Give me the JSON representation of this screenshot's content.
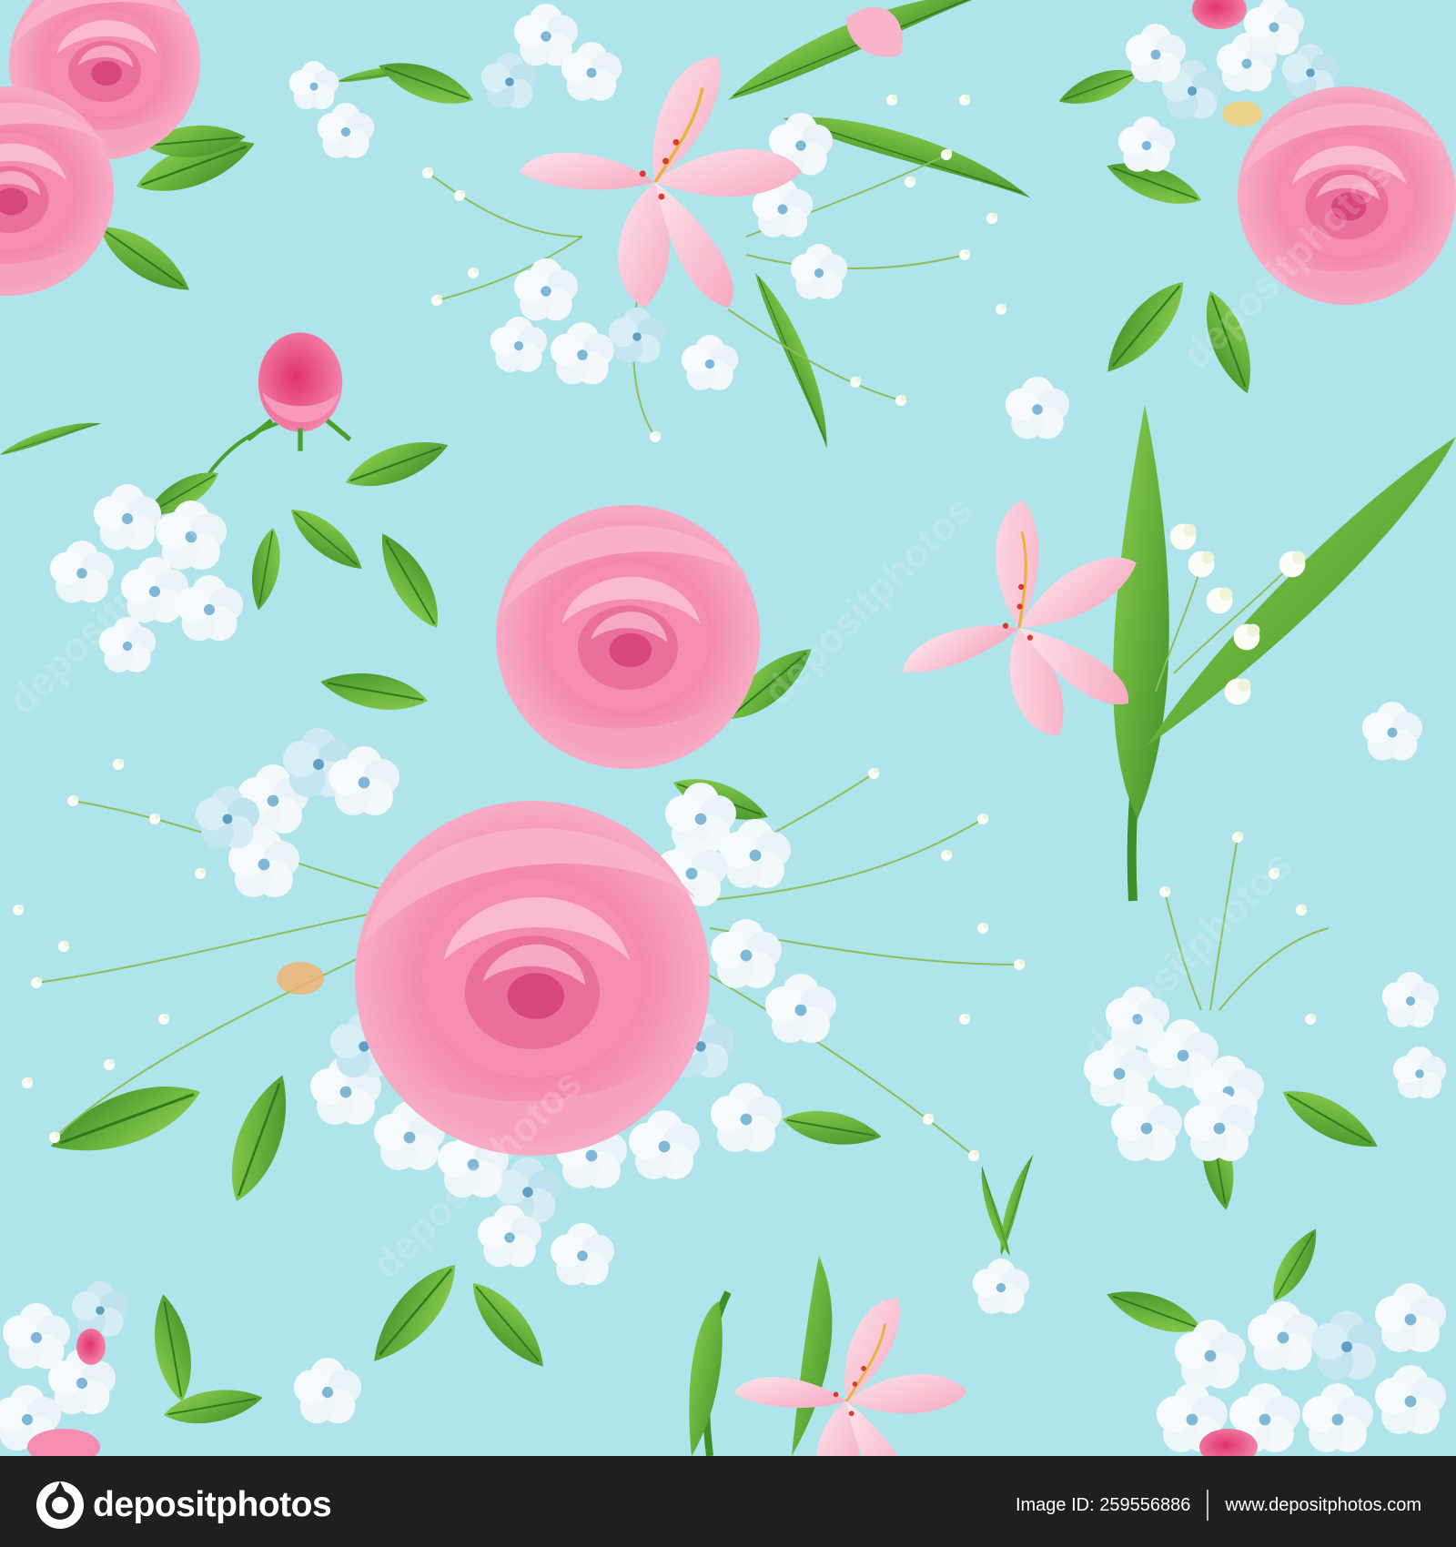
{
  "image": {
    "background_color": "#aee4ea",
    "rose_pink": "#f27fa6",
    "rose_light": "#f9b4cb",
    "leaf_green": "#4a9e2c",
    "leaf_light": "#7cc443",
    "phlox_white": "#f3f8fb",
    "phlox_blue": "#bfe3ee",
    "alstroemeria_pink": "#fbc4d4"
  },
  "watermark": {
    "text": "depositphotos"
  },
  "footer": {
    "background_color": "#1f1f1f",
    "brand": "depositphotos",
    "logo_icon": "camera-shutter-icon",
    "image_id_label": "Image ID: 259556886",
    "site_url": "www.depositphotos.com"
  }
}
